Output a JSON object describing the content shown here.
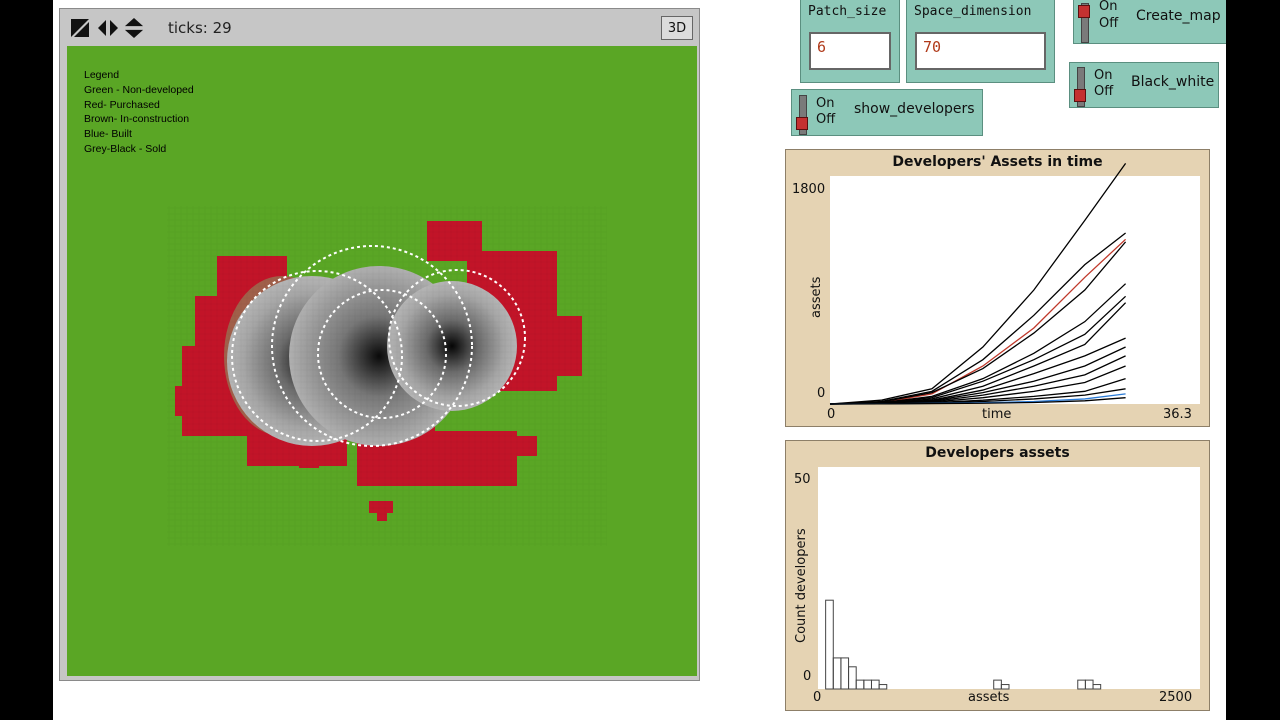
{
  "view": {
    "ticks_text": "ticks: 29",
    "btn_3d": "3D",
    "legend": [
      "Legend",
      "Green - Non-developed",
      "Red- Purchased",
      "Brown- In-construction",
      "Blue- Built",
      "Grey-Black - Sold"
    ]
  },
  "sliders": {
    "patch_size": {
      "label": "Patch_size",
      "value": "6"
    },
    "space_dimension": {
      "label": "Space_dimension",
      "value": "70"
    }
  },
  "switches": {
    "create_map": {
      "on": "On",
      "off": "Off",
      "label": "Create_map"
    },
    "black_white": {
      "on": "On",
      "off": "Off",
      "label": "Black_white"
    },
    "show_developers": {
      "on": "On",
      "off": "Off",
      "label": "show_developers"
    }
  },
  "plot_assets_time": {
    "title": "Developers' Assets in time",
    "ylabel": "assets",
    "xlabel": "time",
    "y_max_label": "1800",
    "y_min_label": "0",
    "x_min_label": "0",
    "x_max_label": "36.3"
  },
  "plot_histogram": {
    "title": "Developers assets",
    "ylabel": "Count developers",
    "xlabel": "assets",
    "y_max_label": "50",
    "y_min_label": "0",
    "x_min_label": "0",
    "x_max_label": "2500"
  },
  "chart_data": [
    {
      "type": "line",
      "title": "Developers' Assets in time",
      "xlabel": "time",
      "ylabel": "assets",
      "xlim": [
        0,
        36.3
      ],
      "ylim": [
        0,
        1800
      ],
      "x": [
        0,
        5,
        10,
        15,
        20,
        25,
        29
      ],
      "series": [
        {
          "color": "#000000",
          "values": [
            0,
            30,
            120,
            450,
            900,
            1450,
            1900
          ]
        },
        {
          "color": "#000000",
          "values": [
            0,
            20,
            100,
            350,
            700,
            1100,
            1350
          ]
        },
        {
          "color": "#c0392b",
          "values": [
            0,
            10,
            80,
            300,
            600,
            1000,
            1300
          ]
        },
        {
          "color": "#000000",
          "values": [
            0,
            15,
            90,
            280,
            560,
            900,
            1280
          ]
        },
        {
          "color": "#000000",
          "values": [
            0,
            10,
            60,
            200,
            400,
            650,
            950
          ]
        },
        {
          "color": "#000000",
          "values": [
            0,
            10,
            50,
            180,
            350,
            550,
            850
          ]
        },
        {
          "color": "#000000",
          "values": [
            0,
            5,
            40,
            140,
            300,
            470,
            800
          ]
        },
        {
          "color": "#000000",
          "values": [
            0,
            5,
            30,
            110,
            240,
            380,
            520
          ]
        },
        {
          "color": "#000000",
          "values": [
            0,
            5,
            25,
            90,
            180,
            300,
            450
          ]
        },
        {
          "color": "#000000",
          "values": [
            0,
            5,
            20,
            70,
            140,
            230,
            380
          ]
        },
        {
          "color": "#000000",
          "values": [
            0,
            3,
            15,
            50,
            100,
            170,
            300
          ]
        },
        {
          "color": "#000000",
          "values": [
            0,
            2,
            10,
            30,
            60,
            100,
            200
          ]
        },
        {
          "color": "#000000",
          "values": [
            0,
            2,
            8,
            20,
            40,
            70,
            120
          ]
        },
        {
          "color": "#2b7bd6",
          "values": [
            0,
            1,
            5,
            10,
            20,
            40,
            80
          ]
        },
        {
          "color": "#000000",
          "values": [
            0,
            1,
            3,
            6,
            12,
            25,
            50
          ]
        }
      ]
    },
    {
      "type": "bar",
      "title": "Developers assets",
      "xlabel": "assets",
      "ylabel": "Count developers",
      "xlim": [
        0,
        2500
      ],
      "ylim": [
        0,
        50
      ],
      "bin_width": 50,
      "bin_starts": [
        0,
        50,
        100,
        150,
        200,
        250,
        300,
        350,
        400,
        450,
        500,
        550,
        600,
        650,
        700,
        750,
        800,
        850,
        900,
        950,
        1000,
        1050,
        1100,
        1150,
        1200,
        1250,
        1300,
        1350,
        1400,
        1450,
        1500,
        1550,
        1600,
        1650,
        1700,
        1750,
        1800,
        1850
      ],
      "values": [
        0,
        20,
        7,
        7,
        5,
        2,
        2,
        2,
        1,
        0,
        0,
        0,
        0,
        0,
        0,
        0,
        0,
        0,
        0,
        0,
        0,
        0,
        0,
        2,
        1,
        0,
        0,
        0,
        0,
        0,
        0,
        0,
        0,
        0,
        2,
        2,
        1,
        0
      ]
    }
  ]
}
